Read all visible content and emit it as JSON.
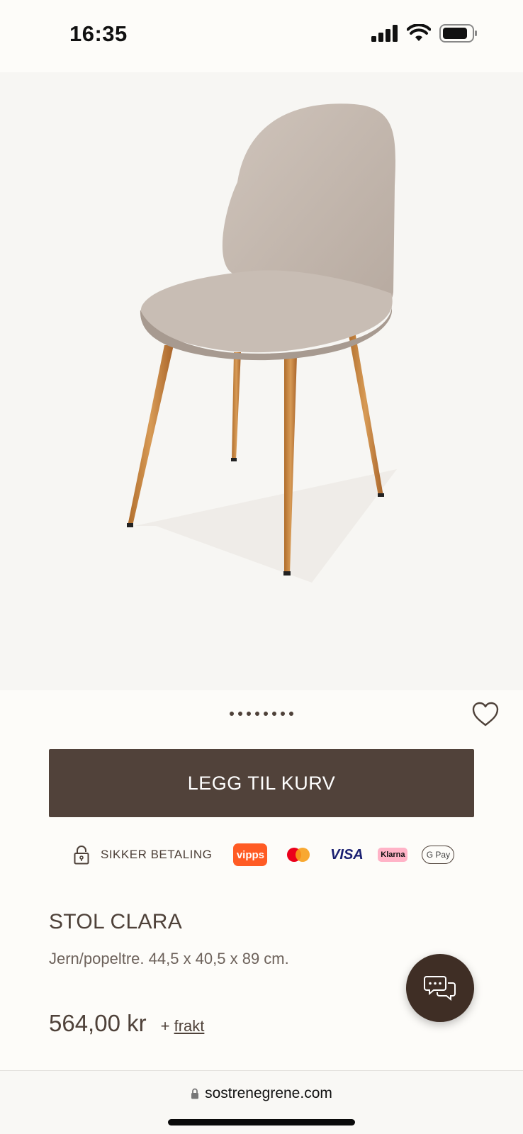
{
  "status_bar": {
    "time": "16:35"
  },
  "carousel": {
    "dot_count": 8
  },
  "actions": {
    "add_to_cart_label": "LEGG TIL KURV"
  },
  "payment": {
    "secure_label": "SIKKER BETALING",
    "methods": {
      "vipps": "vipps",
      "visa": "VISA",
      "klarna": "Klarna",
      "gpay": "G Pay"
    }
  },
  "product": {
    "title": "STOL CLARA",
    "description": "Jern/popeltre. 44,5 x 40,5 x 89 cm.",
    "price": "564,00 kr",
    "shipping_prefix": "+",
    "shipping_link": "frakt"
  },
  "browser": {
    "url": "sostrenegrene.com"
  },
  "colors": {
    "brand_brown": "#51423a",
    "chat_brown": "#3f2e25",
    "text": "#4e4139"
  }
}
